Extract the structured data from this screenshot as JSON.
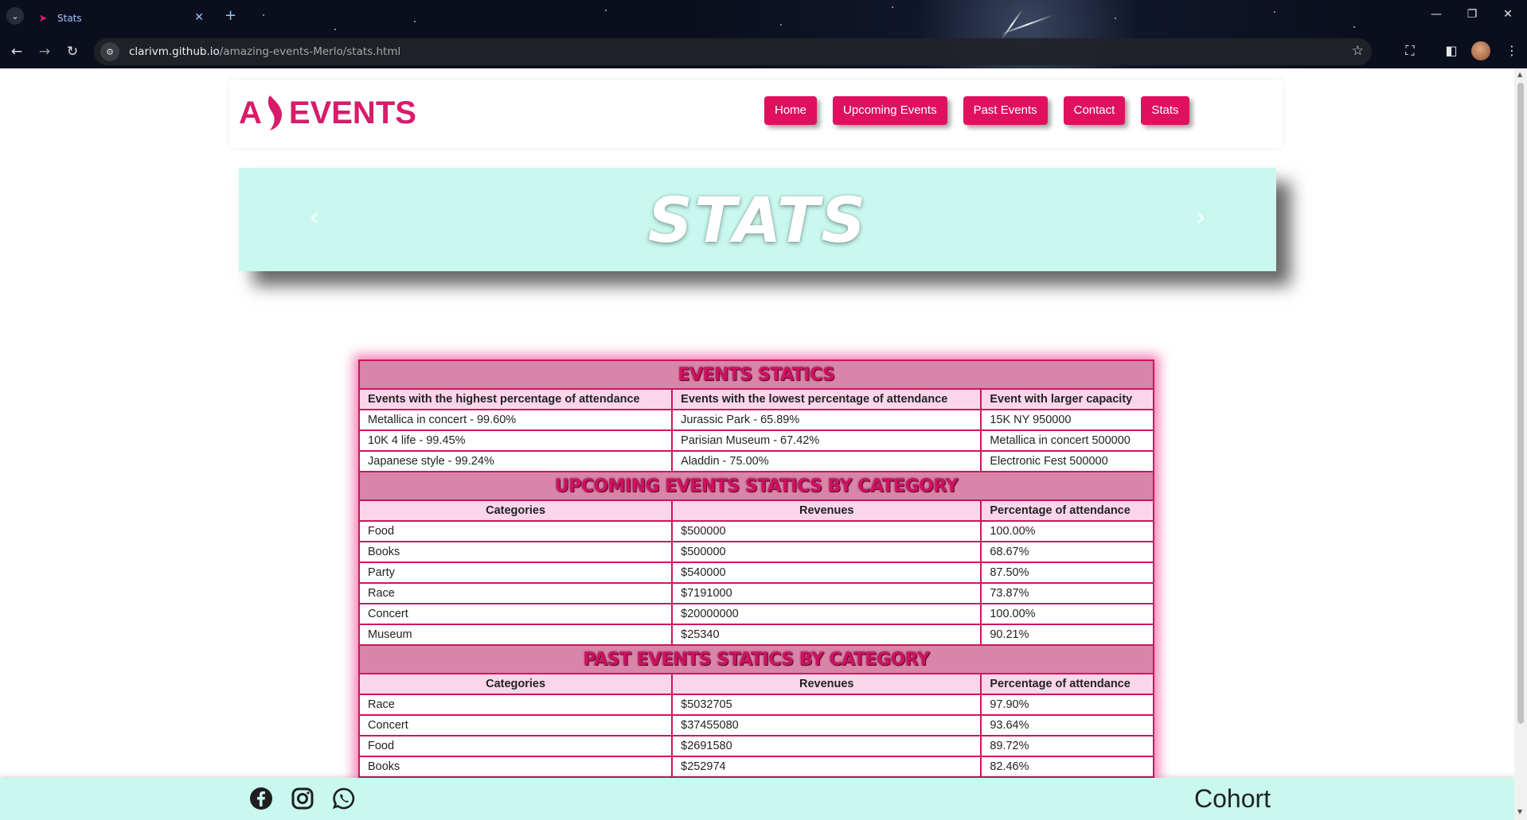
{
  "browser": {
    "tab_title": "Stats",
    "url_host": "clarivm.github.io",
    "url_path": "/amazing-events-Merlo/stats.html"
  },
  "header": {
    "logo_left": "A",
    "logo_right": "EVENTS",
    "nav": [
      "Home",
      "Upcoming Events",
      "Past Events",
      "Contact",
      "Stats"
    ]
  },
  "banner": {
    "title": "STATS"
  },
  "stats": {
    "events_title": "EVENTS STATICS",
    "events_headers": [
      "Events with the highest percentage of attendance",
      "Events with the lowest percentage of attendance",
      "Event with larger capacity"
    ],
    "events_rows": [
      [
        "Metallica in concert - 99.60%",
        "Jurassic Park - 65.89%",
        "15K NY 950000"
      ],
      [
        "10K 4 life - 99.45%",
        "Parisian Museum - 67.42%",
        "Metallica in concert 500000"
      ],
      [
        "Japanese style - 99.24%",
        "Aladdin - 75.00%",
        "Electronic Fest 500000"
      ]
    ],
    "upcoming_title": "UPCOMING EVENTS STATICS BY CATEGORY",
    "upcoming_headers": [
      "Categories",
      "Revenues",
      "Percentage of attendance"
    ],
    "upcoming_rows": [
      [
        "Food",
        "$500000",
        "100.00%"
      ],
      [
        "Books",
        "$500000",
        "68.67%"
      ],
      [
        "Party",
        "$540000",
        "87.50%"
      ],
      [
        "Race",
        "$7191000",
        "73.87%"
      ],
      [
        "Concert",
        "$20000000",
        "100.00%"
      ],
      [
        "Museum",
        "$25340",
        "90.21%"
      ]
    ],
    "past_title": "PAST EVENTS STATICS BY CATEGORY",
    "past_headers": [
      "Categories",
      "Revenues",
      "Percentage of attendance"
    ],
    "past_rows": [
      [
        "Race",
        "$5032705",
        "97.90%"
      ],
      [
        "Concert",
        "$37455080",
        "93.64%"
      ],
      [
        "Food",
        "$2691580",
        "89.72%"
      ],
      [
        "Books",
        "$252974",
        "82.46%"
      ]
    ]
  },
  "footer": {
    "social_icons": [
      "facebook-icon",
      "instagram-icon",
      "whatsapp-icon"
    ],
    "brand": "Cohort"
  },
  "colors": {
    "accent": "#e0105f",
    "mint": "#c8f8ee",
    "section_header_bg": "#d885a8",
    "column_header_bg": "#fbd6ea"
  }
}
